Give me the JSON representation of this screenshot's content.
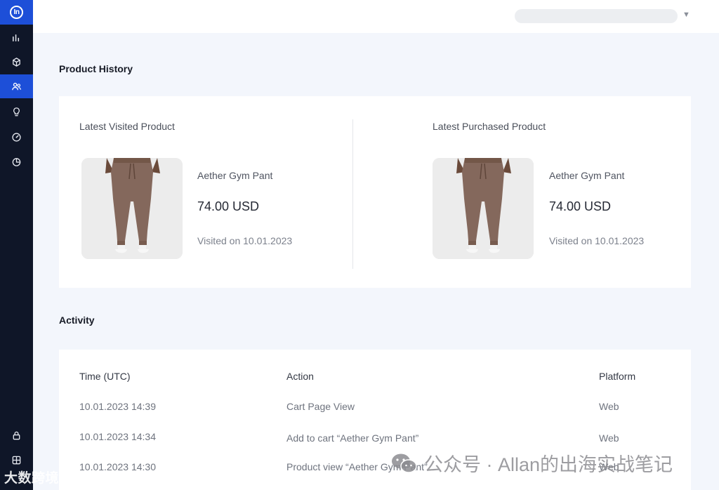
{
  "app": {
    "logo_text": "In"
  },
  "sidebar": {
    "items": [
      {
        "name": "analytics",
        "icon": "bar-chart-icon"
      },
      {
        "name": "products",
        "icon": "cube-icon"
      },
      {
        "name": "customers",
        "icon": "users-icon",
        "active": true
      },
      {
        "name": "insights",
        "icon": "lightbulb-icon"
      },
      {
        "name": "performance",
        "icon": "gauge-icon"
      },
      {
        "name": "reports",
        "icon": "pie-chart-icon"
      }
    ],
    "bottom_items": [
      {
        "name": "security",
        "icon": "lock-icon"
      },
      {
        "name": "apps",
        "icon": "grid-icon"
      }
    ]
  },
  "header": {
    "caret": "▼"
  },
  "product_history": {
    "title": "Product History",
    "visited": {
      "label": "Latest Visited Product",
      "name": "Aether Gym Pant",
      "price": "74.00 USD",
      "date_text": "Visited on 10.01.2023"
    },
    "purchased": {
      "label": "Latest Purchased Product",
      "name": "Aether Gym Pant",
      "price": "74.00 USD",
      "date_text": "Visited on 10.01.2023"
    }
  },
  "activity": {
    "title": "Activity",
    "columns": [
      "Time (UTC)",
      "Action",
      "Platform"
    ],
    "rows": [
      {
        "time": "10.01.2023 14:39",
        "action": "Cart Page View",
        "platform": "Web"
      },
      {
        "time": "10.01.2023 14:34",
        "action": "Add to cart “Aether Gym Pant”",
        "platform": "Web"
      },
      {
        "time": "10.01.2023 14:30",
        "action": "Product view “Aether Gym Pant”",
        "platform": "Web"
      }
    ]
  },
  "watermarks": {
    "left": "大数跨境",
    "right": "公众号 · Allan的出海实战笔记"
  },
  "colors": {
    "sidebar_bg": "#0f1628",
    "accent": "#1d4fd8",
    "page_bg": "#f3f6fc",
    "card_bg": "#ffffff"
  }
}
